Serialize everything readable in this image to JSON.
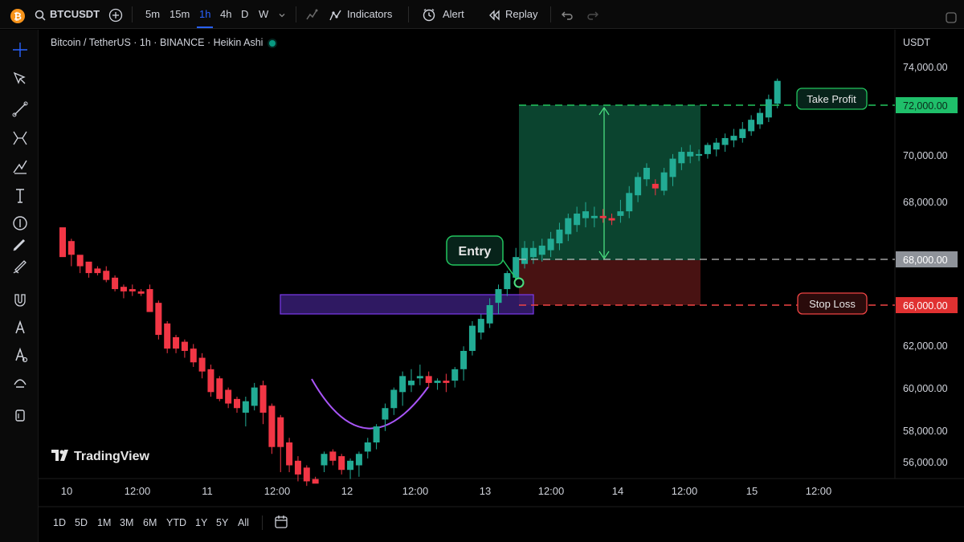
{
  "toolbar": {
    "symbol": "BTCUSDT",
    "intervals": [
      "5m",
      "15m",
      "1h",
      "4h",
      "D",
      "W"
    ],
    "active_interval": "1h",
    "indicators_label": "Indicators",
    "alert_label": "Alert",
    "replay_label": "Replay"
  },
  "legend": {
    "title": "Bitcoin / TetherUS · 1h · BINANCE · Heikin Ashi"
  },
  "price_axis": {
    "currency": "USDT",
    "labels": [
      "74,000.00",
      "70,000.00",
      "68,000.00",
      "62,000.00",
      "60,000.00",
      "58,000.00",
      "56,000.00"
    ],
    "tp_label": "72,000.00",
    "entry_label": "68,000.00",
    "sl_label": "66,000.00"
  },
  "time_axis": {
    "labels": [
      "10",
      "12:00",
      "11",
      "12:00",
      "12",
      "12:00",
      "13",
      "12:00",
      "14",
      "12:00",
      "15",
      "12:00"
    ]
  },
  "annotations": {
    "take_profit": "Take Profit",
    "entry": "Entry",
    "stop_loss": "Stop Loss"
  },
  "brand": "TradingView",
  "ranges": [
    "1D",
    "5D",
    "1M",
    "3M",
    "6M",
    "YTD",
    "1Y",
    "5Y",
    "All"
  ],
  "colors": {
    "up": "#22ab94",
    "down": "#f23645",
    "tp": "#22c55e",
    "sl": "#ef4444",
    "zone": "#7c3aed"
  },
  "chart_data": {
    "type": "candlestick",
    "candles": [
      [
        69400,
        69200,
        68200,
        68100
      ],
      [
        68800,
        68900,
        67700,
        68200
      ],
      [
        68200,
        68100,
        67400,
        67700
      ],
      [
        67900,
        67800,
        67200,
        67400
      ],
      [
        67600,
        67700,
        67300,
        67400
      ],
      [
        67500,
        67700,
        67000,
        67100
      ],
      [
        67200,
        67300,
        66600,
        66700
      ],
      [
        66800,
        66900,
        66300,
        66600
      ],
      [
        66700,
        66900,
        66400,
        66600
      ],
      [
        66600,
        66700,
        66400,
        66500
      ],
      [
        66700,
        66900,
        65900,
        65700
      ],
      [
        66100,
        66200,
        64500,
        64700
      ],
      [
        65200,
        65300,
        63900,
        64100
      ],
      [
        64600,
        64700,
        63900,
        64100
      ],
      [
        64400,
        64500,
        63700,
        64000
      ],
      [
        64100,
        64300,
        63300,
        63500
      ],
      [
        63700,
        63900,
        62800,
        63100
      ],
      [
        63200,
        63400,
        62000,
        62200
      ],
      [
        62800,
        62900,
        61800,
        61900
      ],
      [
        62300,
        62400,
        61500,
        61700
      ],
      [
        61900,
        62000,
        61300,
        61500
      ],
      [
        61300,
        62000,
        60700,
        61800
      ],
      [
        61600,
        62600,
        61400,
        62400
      ],
      [
        62500,
        62700,
        60800,
        61300
      ],
      [
        61600,
        61700,
        59500,
        59800
      ],
      [
        61100,
        61200,
        58700,
        59800
      ],
      [
        60000,
        60200,
        58700,
        59000
      ],
      [
        59200,
        59400,
        58300,
        58600
      ],
      [
        58900,
        59000,
        58100,
        58300
      ],
      [
        58400,
        58500,
        58300,
        58200
      ],
      [
        59000,
        59600,
        58700,
        59500
      ],
      [
        59600,
        59700,
        59000,
        59200
      ],
      [
        59400,
        59500,
        58600,
        58800
      ],
      [
        58800,
        59300,
        58400,
        59200
      ],
      [
        59000,
        59600,
        58500,
        59500
      ],
      [
        59600,
        60200,
        59300,
        60000
      ],
      [
        60000,
        60800,
        59700,
        60700
      ],
      [
        61000,
        61700,
        60500,
        61500
      ],
      [
        61500,
        62400,
        61200,
        62300
      ],
      [
        62200,
        63100,
        61600,
        62900
      ],
      [
        62500,
        63200,
        62200,
        62700
      ],
      [
        62800,
        63400,
        62500,
        62900
      ],
      [
        62900,
        63100,
        62400,
        62600
      ],
      [
        62600,
        62800,
        62300,
        62700
      ],
      [
        62700,
        63000,
        62200,
        62600
      ],
      [
        62700,
        63300,
        62400,
        63200
      ],
      [
        63200,
        64200,
        62700,
        64000
      ],
      [
        64000,
        65300,
        63800,
        65100
      ],
      [
        64800,
        65600,
        64500,
        65400
      ],
      [
        65200,
        66300,
        65000,
        66000
      ],
      [
        66100,
        66900,
        65600,
        66700
      ],
      [
        66700,
        67500,
        66400,
        67400
      ],
      [
        67200,
        68500,
        66900,
        68100
      ],
      [
        67800,
        68800,
        67600,
        68500
      ],
      [
        68100,
        68800,
        67800,
        68500
      ],
      [
        68200,
        68900,
        67900,
        68600
      ],
      [
        68400,
        69200,
        68100,
        68900
      ],
      [
        68700,
        69600,
        68400,
        69300
      ],
      [
        69100,
        70000,
        68800,
        69800
      ],
      [
        69500,
        70300,
        69200,
        70000
      ],
      [
        69800,
        70500,
        69400,
        70100
      ],
      [
        69800,
        70300,
        69400,
        69900
      ],
      [
        69900,
        70200,
        69600,
        69800
      ],
      [
        69800,
        70000,
        69500,
        69700
      ],
      [
        69900,
        70600,
        69600,
        70100
      ],
      [
        70100,
        71200,
        69800,
        70900
      ],
      [
        70800,
        71800,
        70500,
        71600
      ],
      [
        71500,
        72200,
        71200,
        72000
      ],
      [
        71300,
        71500,
        70800,
        71100
      ],
      [
        71000,
        72000,
        70800,
        71800
      ],
      [
        71600,
        72600,
        71200,
        72400
      ],
      [
        72200,
        72900,
        71900,
        72700
      ],
      [
        72500,
        73000,
        72200,
        72700
      ],
      [
        72600,
        72800,
        72300,
        72600
      ],
      [
        72600,
        73100,
        72400,
        73000
      ],
      [
        72800,
        73300,
        72500,
        73100
      ],
      [
        73000,
        73500,
        72700,
        73300
      ],
      [
        73200,
        73700,
        72900,
        73400
      ],
      [
        73300,
        74000,
        73100,
        73700
      ],
      [
        73600,
        74300,
        73400,
        74100
      ],
      [
        73900,
        74600,
        73700,
        74400
      ],
      [
        74200,
        75200,
        74000,
        75000
      ],
      [
        74800,
        75900,
        74600,
        75800
      ]
    ],
    "candle_fields": [
      "open",
      "high",
      "low",
      "close"
    ],
    "take_profit": 72000,
    "entry": 68000,
    "stop_loss": 66000,
    "y_ticks": [
      74000,
      70000,
      68000,
      62000,
      60000,
      58000,
      56000
    ],
    "x_ticks": [
      "10",
      "12:00",
      "11",
      "12:00",
      "12",
      "12:00",
      "13",
      "12:00",
      "14",
      "12:00",
      "15",
      "12:00"
    ]
  }
}
